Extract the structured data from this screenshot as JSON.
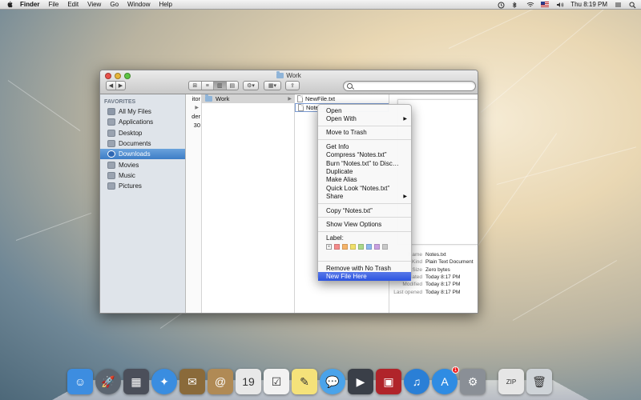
{
  "menubar": {
    "app": "Finder",
    "items": [
      "File",
      "Edit",
      "View",
      "Go",
      "Window",
      "Help"
    ],
    "clock": "Thu 8:19 PM",
    "icons": [
      "apple-icon",
      "time-machine-icon",
      "bluetooth-icon",
      "wifi-icon",
      "flag-icon",
      "volume-icon",
      "spotlight-icon"
    ]
  },
  "window": {
    "title": "Work",
    "search": {
      "placeholder": "",
      "value": ""
    }
  },
  "sidebar": {
    "heading": "FAVORITES",
    "items": [
      {
        "label": "All My Files",
        "icon": "all-files-icon",
        "color": "#8d98a8"
      },
      {
        "label": "Applications",
        "icon": "applications-icon",
        "color": "#9aa3b0"
      },
      {
        "label": "Desktop",
        "icon": "desktop-icon",
        "color": "#9aa3b0"
      },
      {
        "label": "Documents",
        "icon": "documents-icon",
        "color": "#9aa3b0"
      },
      {
        "label": "Downloads",
        "icon": "downloads-icon",
        "color": "#ffffff",
        "selected": true
      },
      {
        "label": "Movies",
        "icon": "movies-icon",
        "color": "#9aa3b0"
      },
      {
        "label": "Music",
        "icon": "music-icon",
        "color": "#9aa3b0"
      },
      {
        "label": "Pictures",
        "icon": "pictures-icon",
        "color": "#9aa3b0"
      }
    ]
  },
  "columns": {
    "col1_partial": [
      "itor",
      "",
      "der",
      "30"
    ],
    "col2": [
      "Work"
    ],
    "col3": [
      "NewFile.txt",
      "Notes.txt"
    ]
  },
  "info": {
    "rows": [
      {
        "k": "Name",
        "v": "Notes.txt"
      },
      {
        "k": "Kind",
        "v": "Plain Text Document"
      },
      {
        "k": "Size",
        "v": "Zero bytes"
      },
      {
        "k": "Created",
        "v": "Today 8:17 PM"
      },
      {
        "k": "Modified",
        "v": "Today 8:17 PM"
      },
      {
        "k": "Last opened",
        "v": "Today 8:17 PM"
      }
    ]
  },
  "context_menu": {
    "open": "Open",
    "open_with": "Open With",
    "move_to_trash": "Move to Trash",
    "get_info": "Get Info",
    "compress": "Compress “Notes.txt”",
    "burn": "Burn “Notes.txt” to Disc…",
    "duplicate": "Duplicate",
    "make_alias": "Make Alias",
    "quick_look": "Quick Look “Notes.txt”",
    "share": "Share",
    "copy": "Copy “Notes.txt”",
    "show_view_options": "Show View Options",
    "label": "Label:",
    "label_colors": [
      "#f48b8b",
      "#f6b46a",
      "#f1e06a",
      "#a9d88a",
      "#8cb8ef",
      "#c8a0e0",
      "#c9c9c9"
    ],
    "remove_no_trash": "Remove with No Trash",
    "new_file_here": "New File Here"
  },
  "dock": {
    "apps": [
      {
        "name": "finder-icon",
        "color": "#3d8de0",
        "glyph": "☺"
      },
      {
        "name": "launchpad-icon",
        "color": "#5c6570",
        "glyph": "🚀"
      },
      {
        "name": "mission-control-icon",
        "color": "#4b4f5a",
        "glyph": "▦"
      },
      {
        "name": "safari-icon",
        "color": "#3a8de0",
        "glyph": "✦"
      },
      {
        "name": "mail-icon",
        "color": "#8a6a3a",
        "glyph": "✉"
      },
      {
        "name": "contacts-icon",
        "color": "#b08a55",
        "glyph": "@"
      },
      {
        "name": "calendar-icon",
        "color": "#e8e8e8",
        "glyph": "19"
      },
      {
        "name": "reminders-icon",
        "color": "#f2f2f2",
        "glyph": "☑"
      },
      {
        "name": "notes-icon",
        "color": "#f5e27a",
        "glyph": "✎"
      },
      {
        "name": "messages-icon",
        "color": "#4aa3ea",
        "glyph": "💬"
      },
      {
        "name": "facetime-icon",
        "color": "#3a3f48",
        "glyph": "▶"
      },
      {
        "name": "photo-booth-icon",
        "color": "#b0242a",
        "glyph": "▣"
      },
      {
        "name": "itunes-icon",
        "color": "#2a7fd6",
        "glyph": "♫"
      },
      {
        "name": "app-store-icon",
        "color": "#2f8ce3",
        "glyph": "A",
        "badge": "1"
      },
      {
        "name": "system-preferences-icon",
        "color": "#8a8f96",
        "glyph": "⚙"
      },
      {
        "name": "archive-icon",
        "color": "#e6e6e6",
        "glyph": "ZIP"
      },
      {
        "name": "trash-icon",
        "color": "#cfd4d8",
        "glyph": "🗑"
      }
    ]
  }
}
